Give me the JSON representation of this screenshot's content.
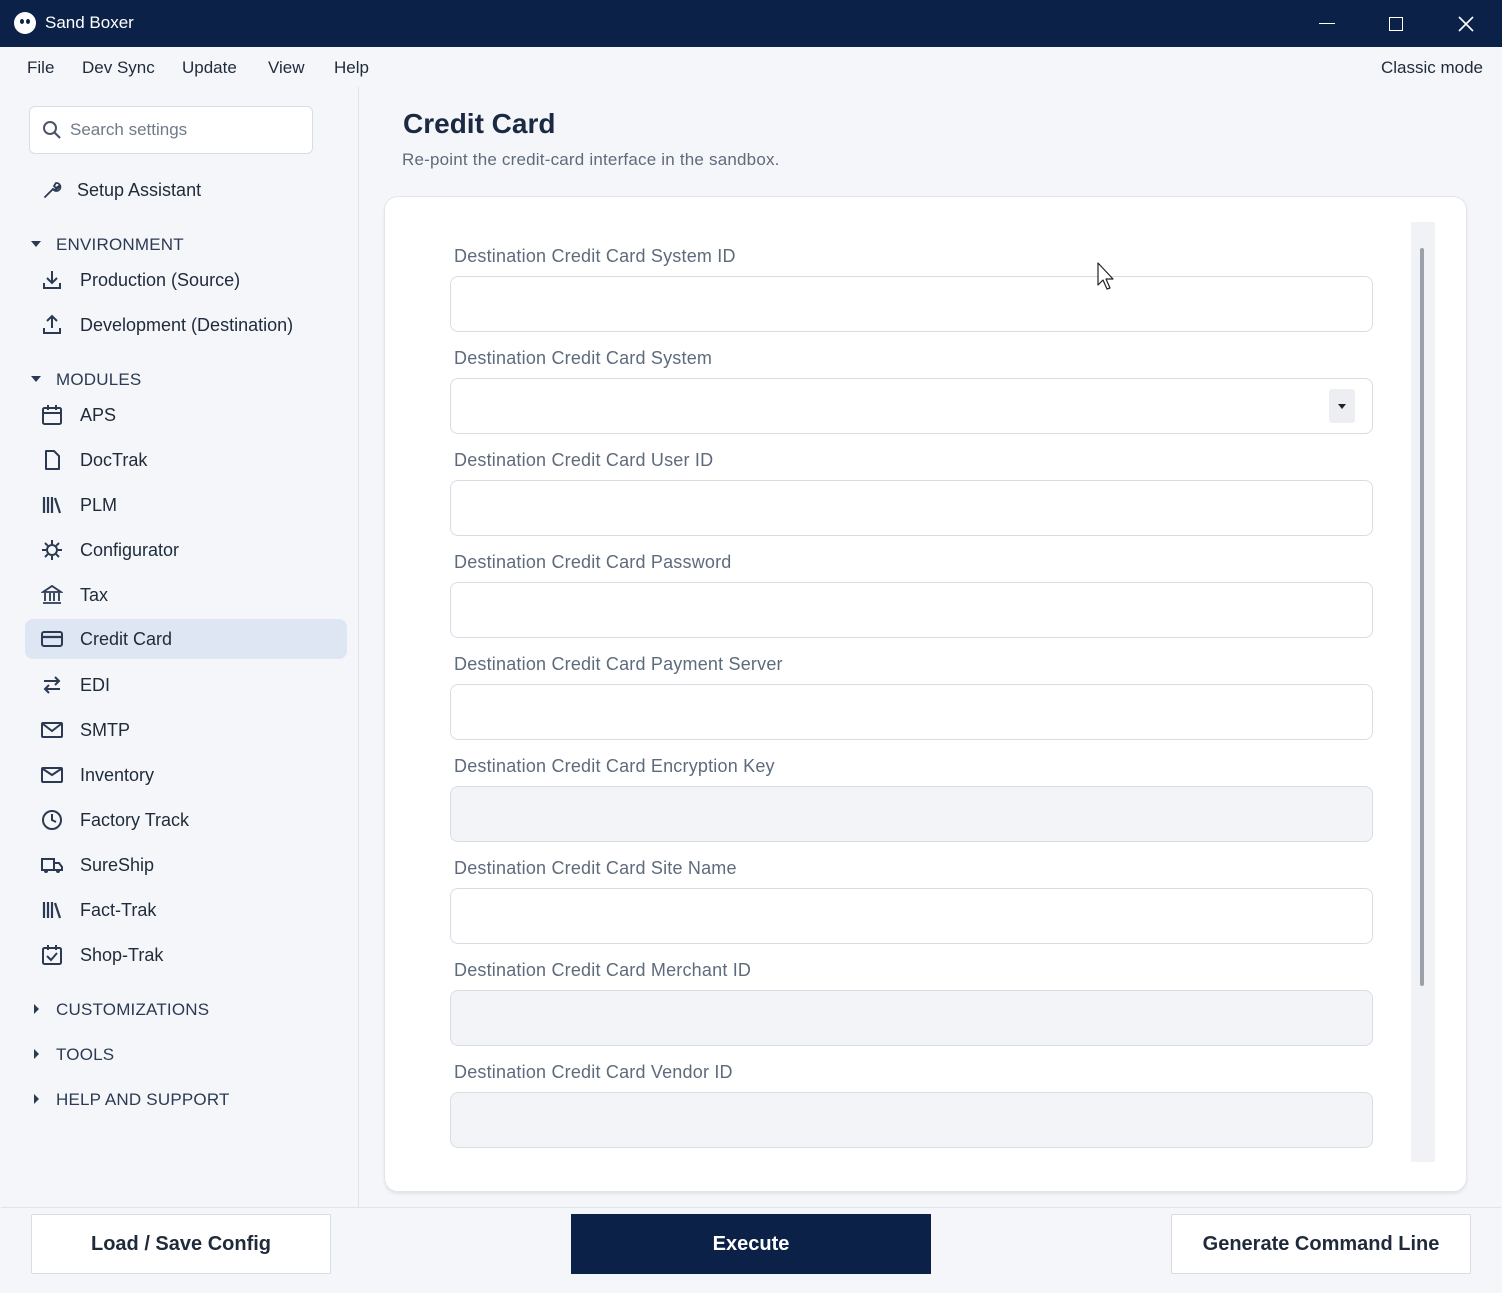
{
  "window": {
    "title": "Sand Boxer"
  },
  "menu": {
    "items": [
      "File",
      "Dev Sync",
      "Update",
      "View",
      "Help"
    ],
    "classic_mode": "Classic mode"
  },
  "sidebar": {
    "search_placeholder": "Search settings",
    "setup_assistant": "Setup Assistant",
    "environment": {
      "heading": "ENVIRONMENT",
      "items": [
        "Production (Source)",
        "Development (Destination)"
      ]
    },
    "modules": {
      "heading": "MODULES",
      "items": [
        "APS",
        "DocTrak",
        "PLM",
        "Configurator",
        "Tax",
        "Credit Card",
        "EDI",
        "SMTP",
        "Inventory",
        "Factory Track",
        "SureShip",
        "Fact-Trak",
        "Shop-Trak"
      ],
      "active": "Credit Card"
    },
    "collapsed_sections": [
      "CUSTOMIZATIONS",
      "TOOLS",
      "HELP AND SUPPORT"
    ]
  },
  "main": {
    "title": "Credit Card",
    "subtitle": "Re-point the credit-card interface in the sandbox.",
    "fields": [
      {
        "label": "Destination Credit Card System ID",
        "value": "",
        "type": "text",
        "disabled": false
      },
      {
        "label": "Destination Credit Card System",
        "value": "",
        "type": "select",
        "disabled": false
      },
      {
        "label": "Destination Credit Card User ID",
        "value": "",
        "type": "text",
        "disabled": false
      },
      {
        "label": "Destination Credit Card Password",
        "value": "",
        "type": "password",
        "disabled": false
      },
      {
        "label": "Destination Credit Card Payment Server",
        "value": "",
        "type": "text",
        "disabled": false
      },
      {
        "label": "Destination Credit Card Encryption Key",
        "value": "",
        "type": "text",
        "disabled": true
      },
      {
        "label": "Destination Credit Card Site Name",
        "value": "",
        "type": "text",
        "disabled": false
      },
      {
        "label": "Destination Credit Card Merchant ID",
        "value": "",
        "type": "text",
        "disabled": true
      },
      {
        "label": "Destination Credit Card Vendor ID",
        "value": "",
        "type": "text",
        "disabled": true
      }
    ]
  },
  "footer": {
    "load_save": "Load / Save Config",
    "execute": "Execute",
    "generate": "Generate Command Line"
  },
  "colors": {
    "navy": "#0b2147",
    "active_bg": "#dee6f3",
    "background": "#f4f6fa"
  }
}
